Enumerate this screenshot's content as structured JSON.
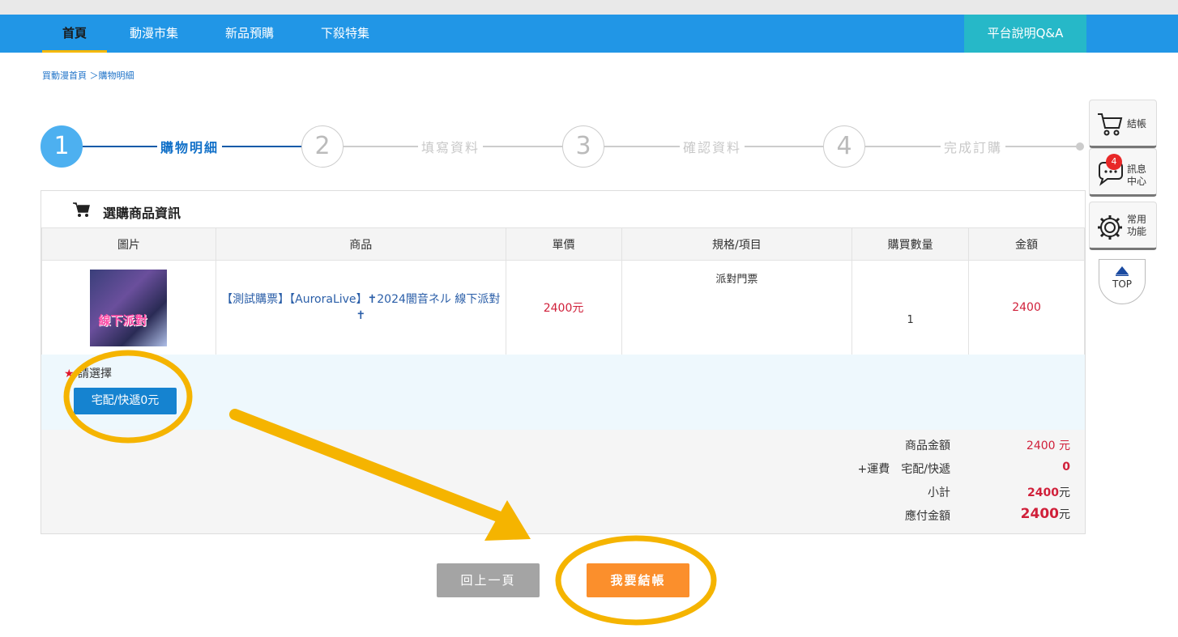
{
  "nav": {
    "items": [
      {
        "label": "首頁"
      },
      {
        "label": "動漫市集"
      },
      {
        "label": "新品預購"
      },
      {
        "label": "下殺特集"
      }
    ],
    "qa_label": "平台說明Q&A"
  },
  "breadcrumb": "買動漫首頁 ＞購物明細",
  "steps": [
    {
      "number": "1",
      "label": "購物明細"
    },
    {
      "number": "2",
      "label": "填寫資料"
    },
    {
      "number": "3",
      "label": "確認資料"
    },
    {
      "number": "4",
      "label": "完成訂購"
    }
  ],
  "panel": {
    "title": "選購商品資訊",
    "columns": [
      "圖片",
      "商品",
      "單價",
      "規格/項目",
      "購買數量",
      "金額"
    ],
    "rows": [
      {
        "image_text": "線下派對",
        "product": "【測試購票】【AuroraLive】✝2024闇音ネル 線下派對 ✝",
        "price": "2400元",
        "spec": "派對門票",
        "qty": "1",
        "amount": "2400"
      }
    ]
  },
  "shipping": {
    "star": "★",
    "label": "請選擇",
    "option": "宅配/快遞0元"
  },
  "summary": {
    "goods_label": "商品金額",
    "goods_value": "2400 元",
    "shipping_label": "+運費　宅配/快遞",
    "shipping_value": "0",
    "subtotal_label": "小計",
    "subtotal_value": "2400",
    "subtotal_unit": "元",
    "total_label": "應付金額",
    "total_value": "2400",
    "total_unit": "元"
  },
  "buttons": {
    "back": "回上一頁",
    "checkout": "我要結帳"
  },
  "sidebar": {
    "checkout": "結帳",
    "messages_line1": "訊息",
    "messages_line2": "中心",
    "badge": "4",
    "tools_line1": "常用",
    "tools_line2": "功能",
    "top": "TOP"
  },
  "colors": {
    "nav": "#2196e6",
    "qa": "#26b8c8",
    "active_step": "#4db0f0",
    "checkout": "#fb8f2c",
    "annotation": "#f5b400"
  }
}
